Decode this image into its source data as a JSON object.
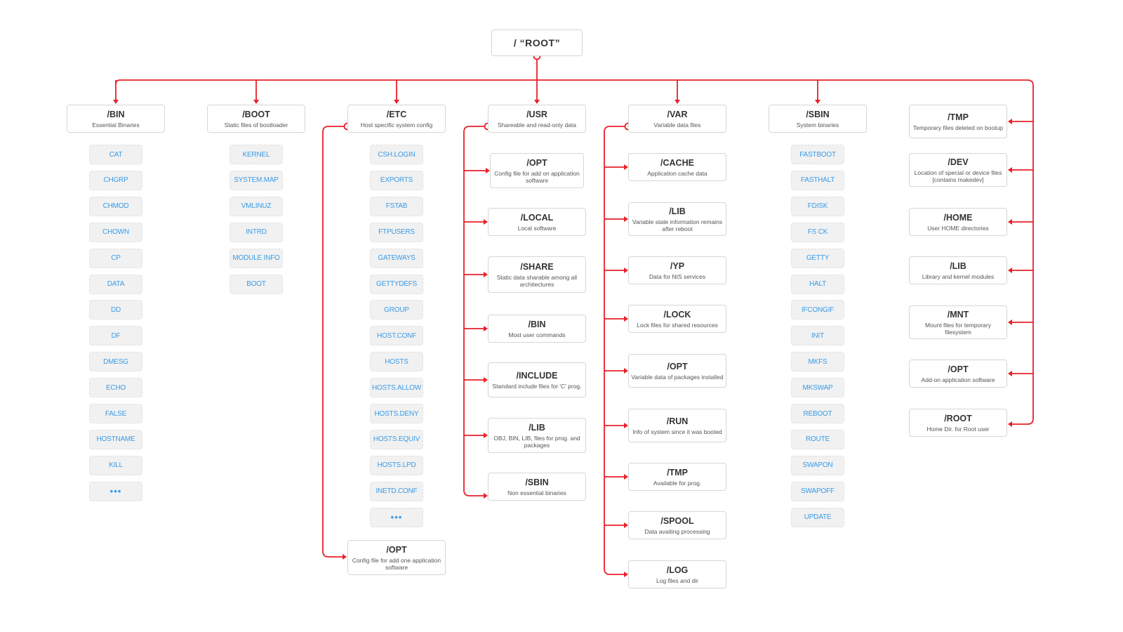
{
  "colors": {
    "connector": "#e8202a",
    "leaf_text": "#3a9be6",
    "title_text": "#333333",
    "desc_text": "#555555"
  },
  "root": {
    "title": "/  “ROOT”"
  },
  "columns": [
    {
      "id": "bin",
      "title": "/BIN",
      "desc": "Essential Binaries",
      "leaves": [
        "CAT",
        "CHGRP",
        "CHMOD",
        "CHOWN",
        "CP",
        "DATA",
        "DD",
        "DF",
        "DMESG",
        "ECHO",
        "FALSE",
        "HOSTNAME",
        "KILL",
        "•••"
      ]
    },
    {
      "id": "boot",
      "title": "/BOOT",
      "desc": "Static files of bootloader",
      "leaves": [
        "KERNEL",
        "SYSTEM.MAP",
        "VMLINUZ",
        "INTRD",
        "MODULE INFO",
        "BOOT"
      ]
    },
    {
      "id": "etc",
      "title": "/ETC",
      "desc": "Host specific system config",
      "leaves": [
        "CSH.LOGIN",
        "EXPORTS",
        "FSTAB",
        "FTPUSERS",
        "GATEWAYS",
        "GETTYDEFS",
        "GROUP",
        "HOST.CONF",
        "HOSTS",
        "HOSTS.ALLOW",
        "HOSTS.DENY",
        "HOSTS.EQUIV",
        "HOSTS.LPD",
        "INETD.CONF",
        "•••"
      ],
      "children": [
        {
          "title": "/OPT",
          "desc": "Config file for add one application software"
        }
      ]
    },
    {
      "id": "usr",
      "title": "/USR",
      "desc": "Shareable and read-only data",
      "children": [
        {
          "title": "/OPT",
          "desc": "Config file for add on application software"
        },
        {
          "title": "/LOCAL",
          "desc": "Local software"
        },
        {
          "title": "/SHARE",
          "desc": "Static data sharable among all architectures"
        },
        {
          "title": "/BIN",
          "desc": "Most user commands"
        },
        {
          "title": "/INCLUDE",
          "desc": "Standard include files for 'C' prog."
        },
        {
          "title": "/LIB",
          "desc": "OBJ, BIN, LIB, files for prog. and packages"
        },
        {
          "title": "/SBIN",
          "desc": "Non essential binaries"
        }
      ]
    },
    {
      "id": "var",
      "title": "/VAR",
      "desc": "Variable data files",
      "children": [
        {
          "title": "/CACHE",
          "desc": "Application cache data"
        },
        {
          "title": "/LIB",
          "desc": "Variable state information remains after reboot"
        },
        {
          "title": "/YP",
          "desc": "Data for NIS services"
        },
        {
          "title": "/LOCK",
          "desc": "Lock files for shared resources"
        },
        {
          "title": "/OPT",
          "desc": "Variable data of packages installed"
        },
        {
          "title": "/RUN",
          "desc": "Info of system since it was booted"
        },
        {
          "title": "/TMP",
          "desc": "Available for prog."
        },
        {
          "title": "/SPOOL",
          "desc": "Data avaiting processing"
        },
        {
          "title": "/LOG",
          "desc": "Log files and dir"
        }
      ]
    },
    {
      "id": "sbin",
      "title": "/SBIN",
      "desc": "System binaries",
      "leaves": [
        "FASTBOOT",
        "FASTHALT",
        "FDISK",
        "FS CK",
        "GETTY",
        "HALT",
        "IFCONGIF",
        "INIT",
        "MKFS",
        "MKSWAP",
        "REBOOT",
        "ROUTE",
        "SWAPON",
        "SWAPOFF",
        "UPDATE"
      ]
    }
  ],
  "right_column": [
    {
      "title": "/TMP",
      "desc": "Temporary files deleted on bootup"
    },
    {
      "title": "/DEV",
      "desc": "Location of special or device files [contains makedev]"
    },
    {
      "title": "/HOME",
      "desc": "User HOME directories"
    },
    {
      "title": "/LIB",
      "desc": "Library and kernel modules"
    },
    {
      "title": "/MNT",
      "desc": "Mount files for temporary filesystem"
    },
    {
      "title": "/OPT",
      "desc": "Add-on application software"
    },
    {
      "title": "/ROOT",
      "desc": "Home Dir. for Root user"
    }
  ]
}
